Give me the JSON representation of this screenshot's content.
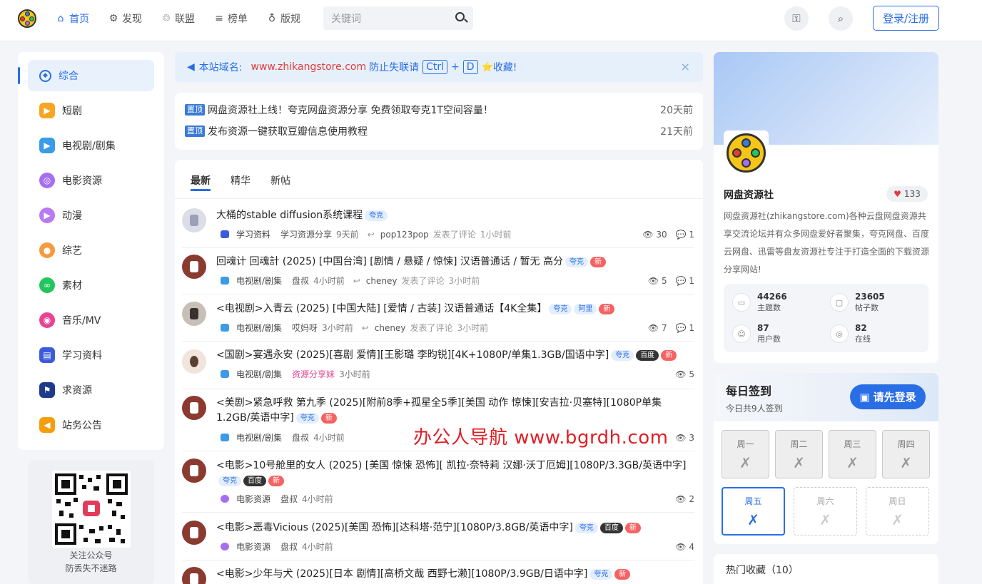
{
  "nav": {
    "items": [
      {
        "label": "首页",
        "icon": "home-icon"
      },
      {
        "label": "发现",
        "icon": "gear-icon"
      },
      {
        "label": "联盟",
        "icon": "handshake-icon"
      },
      {
        "label": "榜单",
        "icon": "chart-icon"
      },
      {
        "label": "版规",
        "icon": "rules-icon"
      }
    ],
    "search_placeholder": "关键词",
    "login_label": "登录/注册"
  },
  "sidebar": {
    "items": [
      {
        "label": "综合",
        "color": "#2a6ee6"
      },
      {
        "label": "短剧",
        "color": "#f6a623"
      },
      {
        "label": "电视剧/剧集",
        "color": "#3a9be6"
      },
      {
        "label": "电影资源",
        "color": "#a66ef2"
      },
      {
        "label": "动漫",
        "color": "#b77af0"
      },
      {
        "label": "综艺",
        "color": "#f59a3e"
      },
      {
        "label": "素材",
        "color": "#22c55e"
      },
      {
        "label": "音乐/MV",
        "color": "#e84393"
      },
      {
        "label": "学习资料",
        "color": "#3b5bdb"
      },
      {
        "label": "求资源",
        "color": "#1e3a8a"
      },
      {
        "label": "站务公告",
        "color": "#f59e0b"
      }
    ],
    "qr_line1": "关注公众号",
    "qr_line2": "防丢失不迷路"
  },
  "notice": {
    "prefix": "本站域名:",
    "domain": "www.zhikangstore.com",
    "text": "防止失联请",
    "key1": "Ctrl",
    "plus": "+",
    "key2": "D",
    "star": "⭐",
    "suffix": "收藏!",
    "close": "×"
  },
  "pinned": [
    {
      "tag": "置顶",
      "title": "网盘资源社上线！夸克网盘资源分享 免费领取夸克1T空间容量！",
      "time": "20天前"
    },
    {
      "tag": "置顶",
      "title": "发布资源一键获取豆瓣信息使用教程",
      "time": "21天前"
    }
  ],
  "feed": {
    "tabs": [
      "最新",
      "精华",
      "新帖"
    ],
    "posts": [
      {
        "title": "大桶的stable diffusion系统课程",
        "tags": [
          "夸克"
        ],
        "cat": "学习资料",
        "author": "学习资源分享",
        "time": "9天前",
        "replier": "pop123pop",
        "reply_text": "发表了评论",
        "reply_time": "1小时前",
        "views": "30",
        "comments": "1"
      },
      {
        "title": "回魂计 回魂計 (2025) [中国台湾] [剧情 / 悬疑 / 惊悚] 汉语普通话 / 暂无 高分",
        "tags": [
          "夸克",
          "新"
        ],
        "cat": "电视剧/剧集",
        "author": "盘叔",
        "time": "4小时前",
        "replier": "cheney",
        "reply_text": "发表了评论",
        "reply_time": "3小时前",
        "views": "5",
        "comments": "1"
      },
      {
        "title": "<电视剧>入青云 (2025) [中国大陆] [爱情 / 古装] 汉语普通话【4K全集】",
        "tags": [
          "夸克",
          "阿里",
          "新"
        ],
        "cat": "电视剧/剧集",
        "author": "哎妈呀",
        "time": "3小时前",
        "replier": "cheney",
        "reply_text": "发表了评论",
        "reply_time": "3小时前",
        "views": "7",
        "comments": "1"
      },
      {
        "title": "<国剧>宴遇永安 (2025)[喜剧 爱情][王影璐 李昀锐][4K+1080P/单集1.3GB/国语中字]",
        "tags": [
          "夸克",
          "百度",
          "新"
        ],
        "cat": "电视剧/剧集",
        "author": "资源分享妹",
        "time": "3小时前",
        "views": "5"
      },
      {
        "title": "<美剧>紧急呼救 第九季 (2025)[附前8季+孤星全5季][美国 动作 惊悚][安吉拉·贝塞特][1080P单集1.2GB/英语中字]",
        "tags": [
          "夸克",
          "新"
        ],
        "cat": "电视剧/剧集",
        "author": "盘叔",
        "time": "4小时前",
        "views": "3"
      },
      {
        "title": "<电影>10号舱里的女人 (2025) [美国 惊悚 恐怖][ 凯拉·奈特莉 汉娜·沃丁厄姆][1080P/3.3GB/英语中字]",
        "tags": [
          "夸克",
          "百度",
          "新"
        ],
        "cat": "电影资源",
        "author": "盘叔",
        "time": "4小时前",
        "views": "2"
      },
      {
        "title": "<电影>恶毒Vicious (2025)[美国 恐怖][达科塔·范宁][1080P/3.8GB/英语中字]",
        "tags": [
          "夸克",
          "百度",
          "新"
        ],
        "cat": "电影资源",
        "author": "盘叔",
        "time": "4小时前",
        "views": "4"
      },
      {
        "title": "<电影>少年与犬 (2025)[日本 剧情][高桥文哉 西野七濑][1080P/3.9GB/日语中字]",
        "tags": [
          "夸克",
          "新"
        ]
      }
    ]
  },
  "profile": {
    "name": "网盘资源社",
    "likes": "133",
    "desc": "网盘资源社(zhikangstore.com)各种云盘网盘资源共享交流论坛并有众多网盘爱好者聚集，夸克网盘、百度云网盘、迅雷等盘友资源社专注于打造全面的下载资源分享网站!",
    "stats": [
      {
        "num": "44266",
        "label": "主题数"
      },
      {
        "num": "23605",
        "label": "帖子数"
      },
      {
        "num": "87",
        "label": "用户数"
      },
      {
        "num": "82",
        "label": "在线"
      }
    ]
  },
  "checkin": {
    "title": "每日签到",
    "subtitle": "今日共9人签到",
    "button": "请先登录",
    "days": [
      "周一",
      "周二",
      "周三",
      "周四",
      "周五",
      "周六",
      "周日"
    ],
    "mark": "✗"
  },
  "hot": {
    "title": "热门收藏（10）"
  },
  "watermark": "办公人导航  www.bgrdh.com"
}
